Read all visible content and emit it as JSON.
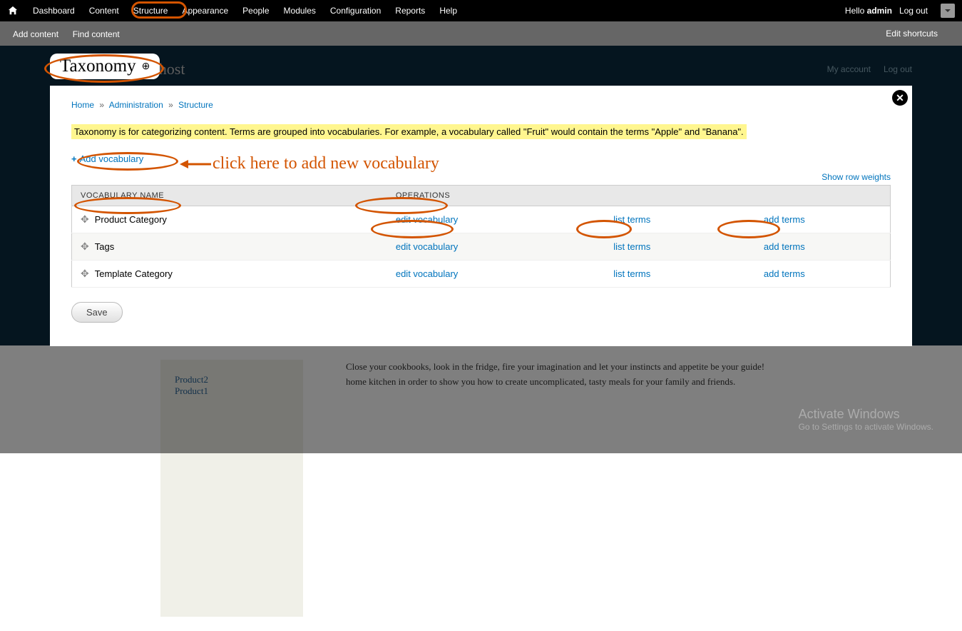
{
  "admin_menu": {
    "items": [
      "Dashboard",
      "Content",
      "Structure",
      "Appearance",
      "People",
      "Modules",
      "Configuration",
      "Reports",
      "Help"
    ],
    "hello": "Hello ",
    "username": "admin",
    "logout": "Log out"
  },
  "shortcuts": {
    "add_content": "Add content",
    "find_content": "Find content",
    "edit_shortcuts": "Edit shortcuts"
  },
  "bg": {
    "site_name": "localhost",
    "my_account": "My account",
    "log_out": "Log out",
    "sidebar": [
      "Product2",
      "Product1"
    ],
    "body1": "Close your cookbooks, look in the fridge, fire your imagination and let your instincts and appetite be your guide!",
    "body2": "home kitchen in order to show you how to create uncomplicated, tasty meals for your family and friends."
  },
  "overlay": {
    "title": "Taxonomy",
    "breadcrumb": {
      "home": "Home",
      "admin": "Administration",
      "structure": "Structure"
    },
    "intro": "Taxonomy is for categorizing content. Terms are grouped into vocabularies. For example, a vocabulary called \"Fruit\" would contain the terms \"Apple\" and \"Banana\".",
    "add_vocab": "Add vocabulary",
    "show_weights": "Show row weights",
    "table": {
      "th_name": "VOCABULARY NAME",
      "th_ops": "OPERATIONS",
      "rows": [
        {
          "name": "Product Category",
          "edit": "edit vocabulary",
          "list": "list terms",
          "add": "add terms"
        },
        {
          "name": "Tags",
          "edit": "edit vocabulary",
          "list": "list terms",
          "add": "add terms"
        },
        {
          "name": "Template Category",
          "edit": "edit vocabulary",
          "list": "list terms",
          "add": "add terms"
        }
      ]
    },
    "save": "Save"
  },
  "annotation": {
    "text": "click here to add new vocabulary"
  },
  "watermark": {
    "line1": "Activate Windows",
    "line2": "Go to Settings to activate Windows."
  }
}
